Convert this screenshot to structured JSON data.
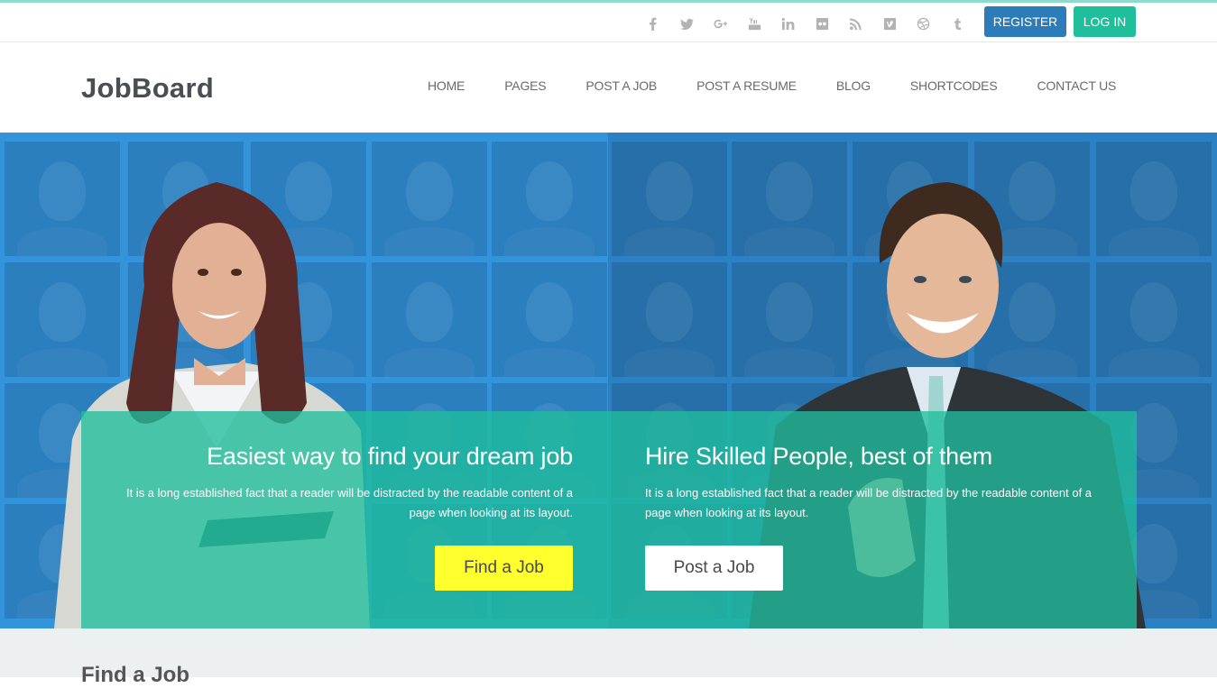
{
  "topbar": {
    "social_icons": [
      {
        "name": "facebook-icon",
        "glyph": "f"
      },
      {
        "name": "twitter-icon",
        "glyph": "t"
      },
      {
        "name": "google-plus-icon",
        "glyph": "g+"
      },
      {
        "name": "youtube-icon",
        "glyph": "yt"
      },
      {
        "name": "linkedin-icon",
        "glyph": "in"
      },
      {
        "name": "flickr-icon",
        "glyph": "••"
      },
      {
        "name": "rss-icon",
        "glyph": "rss"
      },
      {
        "name": "vimeo-icon",
        "glyph": "v"
      },
      {
        "name": "dribbble-icon",
        "glyph": "◎"
      },
      {
        "name": "tumblr-icon",
        "glyph": "t"
      }
    ],
    "register_label": "REGISTER",
    "login_label": "LOG IN"
  },
  "header": {
    "logo": "JobBoard",
    "nav": [
      "HOME",
      "PAGES",
      "POST A JOB",
      "POST A RESUME",
      "BLOG",
      "SHORTCODES",
      "CONTACT US"
    ]
  },
  "hero": {
    "left": {
      "title": "Easiest way to find your dream job",
      "text": "It is a long established fact that a reader will be distracted by the readable content of a page when looking at its layout.",
      "button": "Find a Job"
    },
    "right": {
      "title": "Hire Skilled People, best of them",
      "text": "It is a long established fact that a reader will be distracted by the readable content of a page when looking at its layout.",
      "button": "Post a Job"
    }
  },
  "section": {
    "title": "Find a Job"
  },
  "colors": {
    "accent_top": "#8ddccb",
    "register": "#2b7cb8",
    "login": "#1fbf9c",
    "overlay": "#1fbe9c",
    "find_button": "#ffff2e",
    "hero_blue": "#3394db"
  }
}
